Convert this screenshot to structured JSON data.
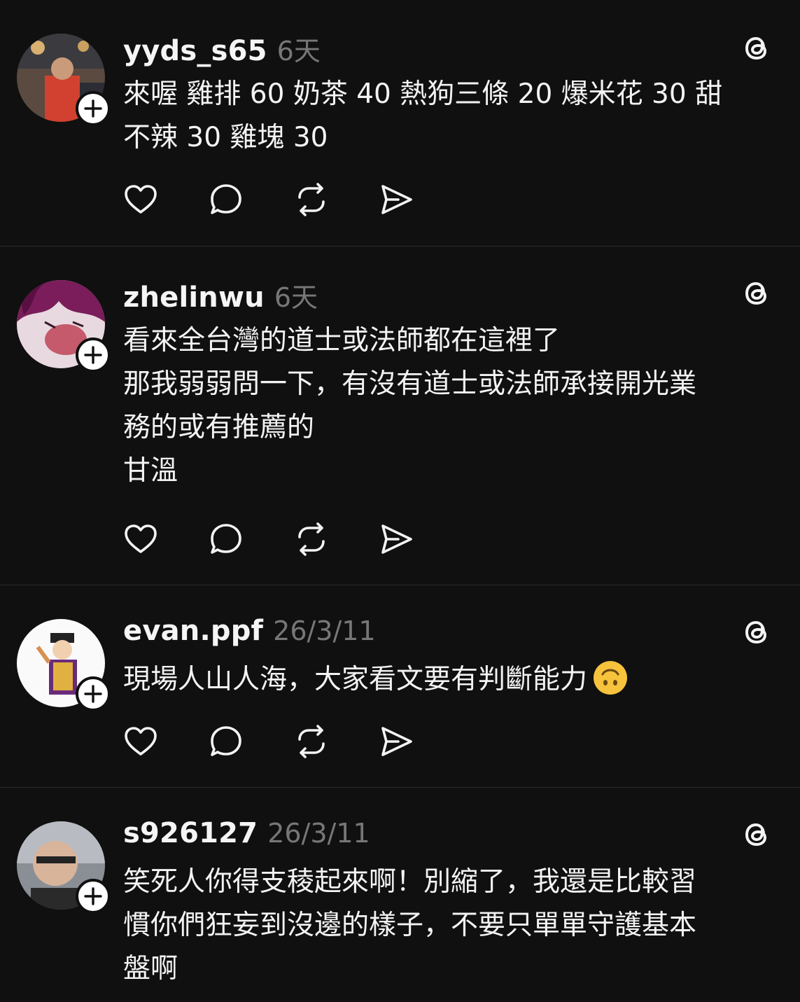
{
  "posts": [
    {
      "username": "yyds_s65",
      "timestamp": "6天",
      "lines": [
        "來喔 雞排 60 奶茶 40 熱狗三條 20 爆米花 30 甜",
        "不辣 30 雞塊 30"
      ]
    },
    {
      "username": "zhelinwu",
      "timestamp": "6天",
      "lines": [
        "看來全台灣的道士或法師都在這裡了",
        "那我弱弱問一下，有沒有道士或法師承接開光業",
        "務的或有推薦的",
        "甘溫"
      ]
    },
    {
      "username": "evan.ppf",
      "timestamp": "26/3/11",
      "lines": [
        "現場人山人海，大家看文要有判斷能力"
      ],
      "emoji": "upside-down-face-emoji"
    },
    {
      "username": "s926127",
      "timestamp": "26/3/11",
      "lines": [
        "笑死人你得支稜起來啊！別縮了，我還是比較習",
        "慣你們狂妄到沒邊的樣子，不要只單單守護基本",
        "盤啊"
      ]
    }
  ],
  "icons": {
    "like": "heart-icon",
    "reply": "speech-bubble-icon",
    "repost": "repost-icon",
    "share": "send-icon",
    "app": "threads-logo-icon",
    "follow": "plus-icon"
  },
  "colors": {
    "background": "#101010",
    "text": "#f3f3f3",
    "muted": "#777777",
    "divider": "#2a2a2a"
  }
}
